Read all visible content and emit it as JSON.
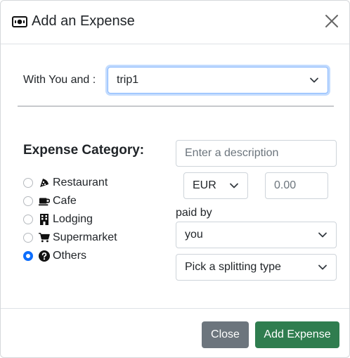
{
  "header": {
    "title": "Add an Expense",
    "icon": "money-bill-icon",
    "close_icon": "close-icon"
  },
  "participants": {
    "label": "With You and :",
    "selected": "trip1"
  },
  "category": {
    "title": "Expense Category:",
    "items": [
      {
        "label": "Restaurant",
        "icon": "pizza-icon",
        "checked": false
      },
      {
        "label": "Cafe",
        "icon": "coffee-mug-icon",
        "checked": false
      },
      {
        "label": "Lodging",
        "icon": "building-icon",
        "checked": false
      },
      {
        "label": "Supermarket",
        "icon": "shopping-cart-icon",
        "checked": false
      },
      {
        "label": "Others",
        "icon": "question-circle-icon",
        "checked": true
      }
    ]
  },
  "form": {
    "description_placeholder": "Enter a description",
    "currency": "EUR",
    "amount_placeholder": "0.00",
    "paid_by_label": "paid by",
    "paid_by_value": "you",
    "split_value": "Pick a splitting type"
  },
  "footer": {
    "close_label": "Close",
    "add_label": "Add Expense"
  },
  "colors": {
    "radio_checked": "#0d6efd",
    "close_button": "#6c757d",
    "add_button": "#2f7d4f"
  }
}
